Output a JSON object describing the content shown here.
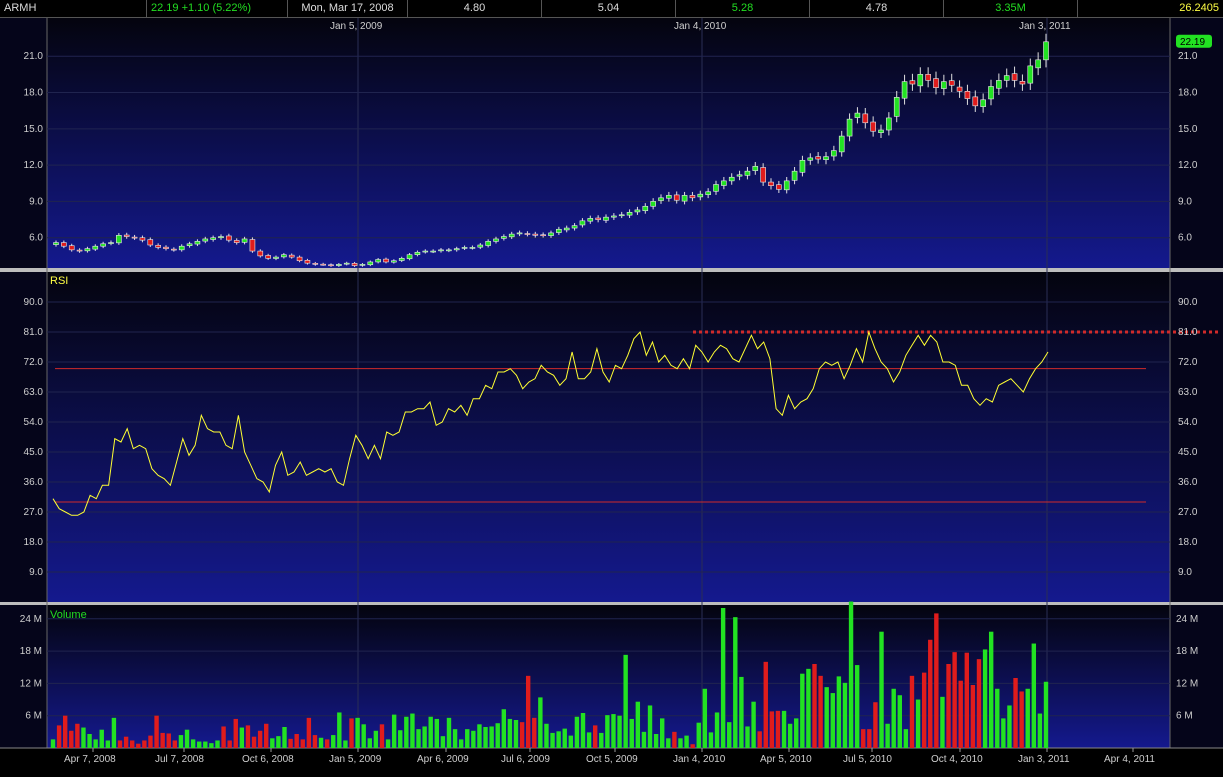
{
  "header": {
    "symbol": "ARMH",
    "price_change": "22.19  +1.10 (5.22%)",
    "date": "Mon, Mar 17, 2008",
    "open": "4.80",
    "high": "5.04",
    "high2": "5.28",
    "low": "4.78",
    "volume": "3.35M",
    "extra": "26.2405"
  },
  "colors": {
    "up": "#22e222",
    "down": "#e01c1c",
    "rsi_line": "#ffff33",
    "ref_line": "#d02a2a",
    "header_green": "#22dd22",
    "header_yellow": "#ffff44"
  },
  "chart_data": [
    {
      "type": "candlestick",
      "panel": "price",
      "last_price_label": "22.19",
      "ylim": [
        3.5,
        23.0
      ],
      "yticks": [
        "6.0",
        "9.0",
        "12.0",
        "15.0",
        "18.0",
        "21.0"
      ],
      "top_date_labels": [
        "Jan 5, 2009",
        "Jan 4, 2010",
        "Jan 3, 2011"
      ],
      "close": [
        5.6,
        5.3,
        5.0,
        4.9,
        5.1,
        5.3,
        5.5,
        5.6,
        6.2,
        6.1,
        6.0,
        5.8,
        5.4,
        5.2,
        5.1,
        5.0,
        5.3,
        5.5,
        5.7,
        5.9,
        6.0,
        6.1,
        5.8,
        5.6,
        5.9,
        4.9,
        4.5,
        4.3,
        4.4,
        4.6,
        4.4,
        4.1,
        3.9,
        3.8,
        3.8,
        3.7,
        3.8,
        3.9,
        3.7,
        3.8,
        4.0,
        4.2,
        4.0,
        4.1,
        4.3,
        4.6,
        4.8,
        4.9,
        4.9,
        5.0,
        5.0,
        5.1,
        5.2,
        5.2,
        5.4,
        5.7,
        5.9,
        6.1,
        6.3,
        6.4,
        6.3,
        6.2,
        6.2,
        6.4,
        6.7,
        6.8,
        7.0,
        7.4,
        7.6,
        7.5,
        7.7,
        7.8,
        7.9,
        8.1,
        8.3,
        8.6,
        9.0,
        9.3,
        9.5,
        9.1,
        9.5,
        9.3,
        9.6,
        9.8,
        10.4,
        10.7,
        11.0,
        11.2,
        11.5,
        11.9,
        10.6,
        10.3,
        10.0,
        10.7,
        11.5,
        12.4,
        12.6,
        12.5,
        12.7,
        13.2,
        14.4,
        15.8,
        16.3,
        15.5,
        14.8,
        14.9,
        15.9,
        17.6,
        18.9,
        18.7,
        19.5,
        19.0,
        18.4,
        18.9,
        18.6,
        18.1,
        17.5,
        16.9,
        17.4,
        18.5,
        19.0,
        19.4,
        19.0,
        18.7,
        20.2,
        20.7,
        22.19
      ],
      "volume_label": "Volume",
      "volume_ylim": [
        0,
        26
      ],
      "volume_yticks": [
        "6 M",
        "12 M",
        "18 M",
        "24 M"
      ],
      "volume_m": [
        1.6,
        4.2,
        6.0,
        3.2,
        4.5,
        3.8,
        2.6,
        1.6,
        3.4,
        1.4,
        5.6,
        1.4,
        2.1,
        1.4,
        0.8,
        1.4,
        2.3,
        6.0,
        2.8,
        2.7,
        1.4,
        2.4,
        3.4,
        1.6,
        1.2,
        1.2,
        0.9,
        1.4,
        4.0,
        1.4,
        5.4,
        3.8,
        4.2,
        2.1,
        3.2,
        4.5,
        1.8,
        2.2,
        3.9,
        1.7,
        2.6,
        1.6,
        5.6,
        2.4,
        1.9,
        1.6,
        2.4,
        6.6,
        1.4,
        5.5,
        5.6,
        4.4,
        1.8,
        3.2,
        4.4,
        1.6,
        6.2,
        3.3,
        5.8,
        6.4,
        3.5,
        4.0,
        5.8,
        5.4,
        2.2,
        5.6,
        3.5,
        1.6,
        3.5,
        3.2,
        4.4,
        3.9,
        4.0,
        4.6,
        7.2,
        5.4,
        5.2,
        4.8,
        13.4,
        5.6,
        9.4,
        4.5,
        2.8,
        3.1,
        3.6,
        2.3,
        5.8,
        6.5,
        2.9,
        4.2,
        2.8,
        6.1,
        6.3,
        6.0,
        17.3,
        5.4,
        8.6,
        3.0,
        7.9,
        2.6,
        5.5,
        1.8,
        3.0,
        1.8,
        2.3,
        0.7,
        4.7,
        11.0,
        2.9,
        6.6,
        26.0,
        4.8,
        24.3,
        13.2,
        4.0,
        8.6,
        3.1,
        16.0,
        6.8,
        6.9,
        6.9,
        4.5,
        5.5,
        13.8,
        14.7,
        15.6,
        13.4,
        11.3,
        10.2,
        13.3,
        12.1,
        27.2,
        15.4,
        3.5,
        3.5,
        8.5,
        21.6,
        4.5,
        11.0,
        9.8,
        3.5,
        13.4,
        9.0,
        14.0,
        20.1,
        25.0,
        9.5,
        15.6,
        17.8,
        12.5,
        17.7,
        11.7,
        16.5,
        18.3,
        21.6,
        11.0,
        5.5,
        7.9,
        13.0,
        10.5,
        11.0,
        19.4,
        6.4,
        12.3
      ]
    },
    {
      "type": "line",
      "panel": "rsi",
      "name": "RSI",
      "ylim": [
        0,
        99
      ],
      "yticks": [
        "9.0",
        "18.0",
        "27.0",
        "36.0",
        "45.0",
        "54.0",
        "63.0",
        "72.0",
        "81.0",
        "90.0"
      ],
      "ref_lines": [
        70,
        30
      ],
      "dotted_ref": 81,
      "values": [
        31,
        28,
        27,
        26,
        26,
        27,
        32,
        31,
        35,
        35,
        49,
        48,
        52,
        46,
        47,
        46,
        40,
        38,
        37,
        35,
        42,
        49,
        44,
        47,
        56,
        52,
        51,
        51,
        47,
        46,
        56,
        45,
        41,
        37,
        36,
        33,
        41,
        45,
        38,
        39,
        42,
        38,
        39,
        40,
        39,
        40,
        36,
        35,
        43,
        50,
        47,
        43,
        47,
        43,
        51,
        50,
        51,
        57,
        57,
        58,
        58,
        60,
        53,
        54,
        58,
        57,
        59,
        56,
        61,
        61,
        65,
        64,
        69,
        69,
        70,
        68,
        64,
        66,
        67,
        71,
        69,
        68,
        65,
        67,
        75,
        67,
        67,
        69,
        76,
        69,
        66,
        71,
        70,
        74,
        79,
        81,
        74,
        78,
        72,
        74,
        71,
        70,
        73,
        70,
        77,
        75,
        72,
        75,
        77,
        76,
        73,
        72,
        76,
        80,
        76,
        78,
        73,
        58,
        56,
        62,
        58,
        60,
        61,
        64,
        70,
        72,
        71,
        72,
        67,
        71,
        76,
        72,
        81,
        76,
        72,
        70,
        66,
        69,
        74,
        77,
        80,
        77,
        80,
        78,
        72,
        72,
        71,
        65,
        65,
        61,
        59,
        61,
        60,
        65,
        66,
        67,
        65,
        63,
        67,
        70,
        72,
        75
      ]
    }
  ],
  "x_axis": {
    "labels": [
      "Apr 7, 2008",
      "Jul 7, 2008",
      "Oct 6, 2008",
      "Jan 5, 2009",
      "Apr 6, 2009",
      "Jul 6, 2009",
      "Oct 5, 2009",
      "Jan 4, 2010",
      "Apr 5, 2010",
      "Jul 5, 2010",
      "Oct 4, 2010",
      "Jan 3, 2011",
      "Apr 4, 2011"
    ]
  }
}
